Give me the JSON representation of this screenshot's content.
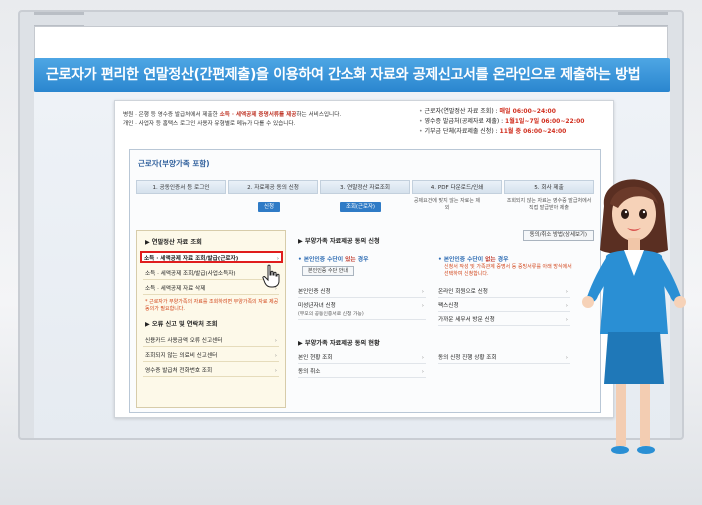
{
  "title": "근로자가 편리한 연말정산(간편제출)을 이용하여 간소화 자료와 공제신고서를 온라인으로 제출하는 방법",
  "intro": {
    "line1_pre": "병원 · 은행 등 영수증 발급처에서 제출한 ",
    "line1_hl": "소득 · 세액공제 증명서류를 제공",
    "line1_post": "하는 서비스입니다.",
    "line2": "개인 · 사업자 등 홈택스 로그인 사용자 유형별로 메뉴가 다를 수 있습니다."
  },
  "schedule": [
    {
      "label": "근로자(연말정산 자료 조회) : ",
      "value": "매일 ",
      "time": "06:00~24:00"
    },
    {
      "label": "영수증 발급처(공제자료 제출) : ",
      "value": "1월1일~7일 ",
      "time": "06:00~22:00"
    },
    {
      "label": "기부금 단체(자료제출 신청) : ",
      "value": "11월 중 ",
      "time": "06:00~24:00"
    }
  ],
  "box_title": "근로자(부양가족 포함)",
  "steps": [
    "1. 공동인증서 등 로그인",
    "2. 자료제공 동의 신청",
    "3. 연말정산 자료조회",
    "4. PDF 다운로드/인쇄",
    "5. 회사 제출"
  ],
  "step_buttons": [
    "신청",
    "조회(근로자)"
  ],
  "step_notes": [
    "공제요건에 맞지 않는 자료는 제외",
    "조회되지 않는 자료는 영수증 발급처에서 직접 발급받아 제출"
  ],
  "left_panel": {
    "heading1": "▶ 연말정산 자료 조회",
    "items1": [
      "소득 · 세액공제 자료 조회/발급(근로자)",
      "소득 · 세액공제 조회/발급(사업소득자)",
      "소득 · 세액공제 자료 삭제"
    ],
    "warning": "* 근로자가 부양가족의 자료를 조회하려면 부양가족의 자료 제공동의가 필요합니다.",
    "heading2": "▶ 오류 신고 및 연락처 조회",
    "items2": [
      "신용카드 사용금액 오류 신고센터",
      "조회되지 않는 의료비 신고센터",
      "영수증 발급처 전화번호 조회"
    ]
  },
  "right_panel": {
    "heading1": "▶ 부양가족 자료제공 동의 신청",
    "tool_button": "동의/취소 방법(상세보기)",
    "case1_title": "• 본인인증 수단이 ",
    "case1_title_neg": "있는",
    "case1_title_post": " 경우",
    "case1_button": "본인인증 수단 안내",
    "case2_title": "• 본인인증 수단이 ",
    "case2_title_neg": "없는",
    "case2_title_post": " 경우",
    "case2_note": "신청서 작성 및 가족관계 증명서 등 증빙서류를 아래 방식에서 선택하여 신청합니다.",
    "left_items": [
      "본인인증 신청",
      "미성년자녀 신청"
    ],
    "left_sub": "(부모의 공동인증서로 신청 가능)",
    "right_items": [
      "온라인 회원으로 신청",
      "팩스신청",
      "가까운 세무서 방문 신청"
    ],
    "heading2": "▶ 부양가족 자료제공 동의 현황",
    "status_left": [
      "본인 현황 조회",
      "동의 취소"
    ],
    "status_right": [
      "동의 신청 진행 상황 조회"
    ]
  },
  "colors": {
    "title_band": "#2a86cf",
    "highlight_border": "#e01d1d",
    "accent_red": "#d12f1f"
  }
}
